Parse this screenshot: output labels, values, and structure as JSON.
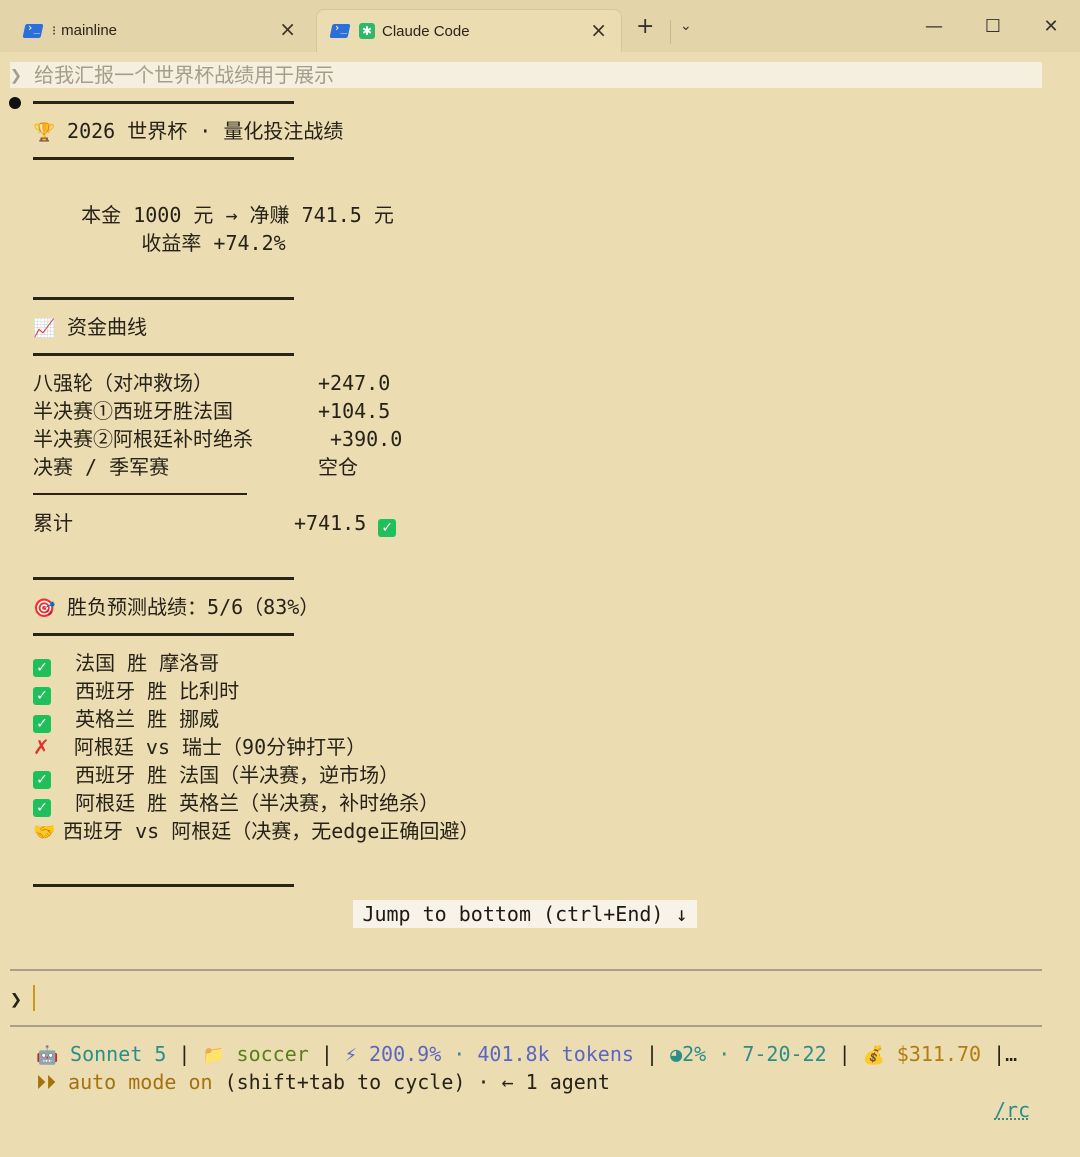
{
  "tabs": [
    {
      "title": "mainline",
      "icon": "powershell-icon",
      "active": false
    },
    {
      "title": "Claude Code",
      "icon": "powershell-icon",
      "active": true
    }
  ],
  "window": {
    "minimize": "—",
    "maximize": "☐",
    "close": "✕",
    "new_tab": "+",
    "dropdown": "⌄"
  },
  "prompt": {
    "chevron": "❯",
    "text": "给我汇报一个世界杯战绩用于展示"
  },
  "report": {
    "title": "2026 世界杯 · 量化投注战绩",
    "summary_line1": "    本金 1000 元 → 净赚 741.5 元",
    "summary_line2": "         收益率 +74.2%",
    "curve_title": "资金曲线",
    "curve_rows": [
      {
        "label": "八强轮（对冲救场）",
        "value": "+247.0"
      },
      {
        "label": "半决赛①西班牙胜法国",
        "value": "+104.5"
      },
      {
        "label": "半决赛②阿根廷补时绝杀",
        "value": "+390.0"
      },
      {
        "label": "决赛 / 季军赛",
        "value": "空仓"
      }
    ],
    "total_label": "累计",
    "total_value": "+741.5",
    "prediction_title": "胜负预测战绩：5/6（83%）",
    "predictions": [
      {
        "mark": "check",
        "text": "法国 胜 摩洛哥"
      },
      {
        "mark": "check",
        "text": "西班牙 胜 比利时"
      },
      {
        "mark": "check",
        "text": "英格兰 胜 挪威"
      },
      {
        "mark": "cross",
        "text": "阿根廷 vs 瑞士（90分钟打平）"
      },
      {
        "mark": "check",
        "text": "西班牙 胜 法国（半决赛，逆市场）"
      },
      {
        "mark": "check",
        "text": "阿根廷 胜 英格兰（半决赛，补时绝杀）"
      },
      {
        "mark": "handshake",
        "text": "西班牙 vs 阿根廷（决赛，无edge正确回避）"
      }
    ]
  },
  "jump_button": "Jump to bottom (ctrl+End) ↓",
  "input": {
    "chevron": "❯"
  },
  "status": {
    "model": "Sonnet 5",
    "folder": "soccer",
    "usage": "200.9%",
    "tokens": "401.8k tokens",
    "context": "2%",
    "window": "7-20-22",
    "cost": "$311.70",
    "mode_text": "auto mode on",
    "mode_hint": "(shift+tab to cycle) · ← 1 agent",
    "rc": "/rc"
  }
}
